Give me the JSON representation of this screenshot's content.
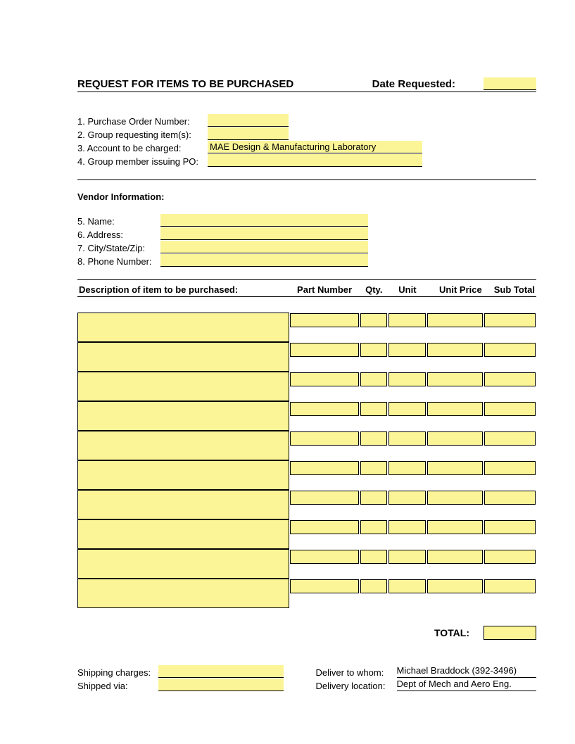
{
  "header": {
    "title": "REQUEST FOR ITEMS TO BE PURCHASED",
    "date_label": "Date Requested:",
    "date_value": ""
  },
  "meta": {
    "po_label": "1. Purchase Order Number:",
    "po_value": "",
    "group_label": "2. Group requesting item(s):",
    "group_value": "",
    "account_label": "3. Account to be charged:",
    "account_value": "MAE Design & Manufacturing Laboratory",
    "member_label": "4. Group member issuing PO:",
    "member_value": ""
  },
  "vendor": {
    "section_title": "Vendor Information:",
    "name_label": "5. Name:",
    "name_value": "",
    "address_label": "6. Address:",
    "address_value": "",
    "csz_label": "7. City/State/Zip:",
    "csz_value": "",
    "phone_label": "8. Phone Number:",
    "phone_value": ""
  },
  "table": {
    "headers": {
      "description": "Description of item to be purchased:",
      "part": "Part Number",
      "qty": "Qty.",
      "unit": "Unit",
      "price": "Unit Price",
      "sub": "Sub Total"
    },
    "rows": [
      {
        "description": "",
        "part": "",
        "qty": "",
        "unit": "",
        "price": "",
        "sub": ""
      },
      {
        "description": "",
        "part": "",
        "qty": "",
        "unit": "",
        "price": "",
        "sub": ""
      },
      {
        "description": "",
        "part": "",
        "qty": "",
        "unit": "",
        "price": "",
        "sub": ""
      },
      {
        "description": "",
        "part": "",
        "qty": "",
        "unit": "",
        "price": "",
        "sub": ""
      },
      {
        "description": "",
        "part": "",
        "qty": "",
        "unit": "",
        "price": "",
        "sub": ""
      },
      {
        "description": "",
        "part": "",
        "qty": "",
        "unit": "",
        "price": "",
        "sub": ""
      },
      {
        "description": "",
        "part": "",
        "qty": "",
        "unit": "",
        "price": "",
        "sub": ""
      },
      {
        "description": "",
        "part": "",
        "qty": "",
        "unit": "",
        "price": "",
        "sub": ""
      },
      {
        "description": "",
        "part": "",
        "qty": "",
        "unit": "",
        "price": "",
        "sub": ""
      },
      {
        "description": "",
        "part": "",
        "qty": "",
        "unit": "",
        "price": "",
        "sub": ""
      }
    ]
  },
  "total": {
    "label": "TOTAL:",
    "value": ""
  },
  "footer": {
    "shipping_charges_label": "Shipping charges:",
    "shipping_charges_value": "",
    "shipped_via_label": "Shipped via:",
    "shipped_via_value": "",
    "deliver_to_label": "Deliver to whom:",
    "deliver_to_value": "Michael Braddock (392-3496)",
    "delivery_loc_label": "Delivery location:",
    "delivery_loc_value": "Dept of Mech and Aero Eng."
  },
  "colors": {
    "highlight": "#fbf598"
  }
}
